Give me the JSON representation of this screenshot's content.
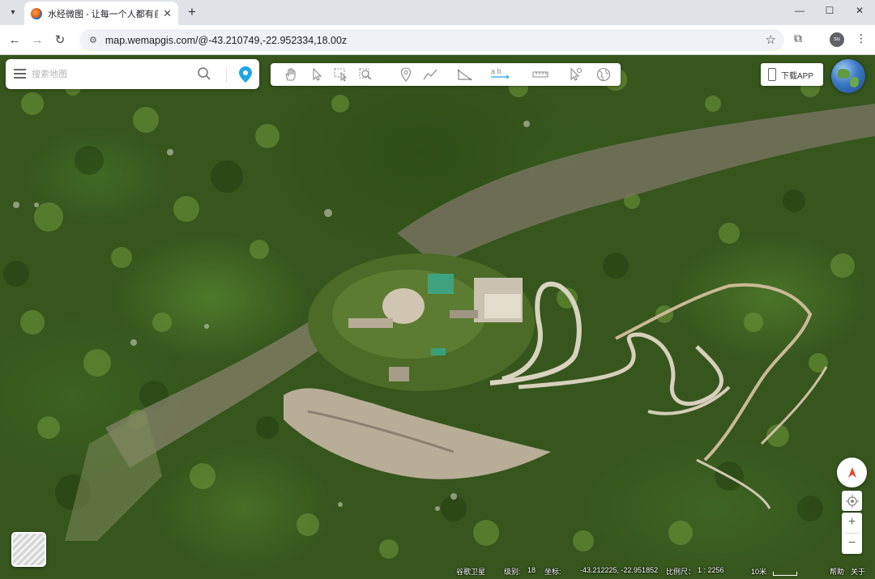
{
  "browser": {
    "tab_title": "水经微图 - 让每一个人都有自己",
    "url": "map.wemapgis.com/@-43.210749,-22.952334,18.00z",
    "profile_initials": "su",
    "new_tab_label": "+",
    "close_tab_label": "✕",
    "minimize_label": "—",
    "maximize_label": "☐",
    "close_window_label": "✕"
  },
  "search": {
    "placeholder": "搜索地图"
  },
  "toolbar": {
    "tools": [
      "pan-hand",
      "select-arrow",
      "box-select",
      "zoom-search",
      "marker",
      "polyline",
      "polygon",
      "text-label",
      "measure-ruler",
      "cursor-info",
      "globe-3d"
    ],
    "text_tool_label": "a b"
  },
  "download_app": {
    "label": "下载APP"
  },
  "status": {
    "source": "谷歌卫星",
    "level_label": "级别:",
    "level_value": "18",
    "coord_label": "坐标:",
    "coord_value": "-43.212225, -22.951852",
    "scale_label": "比例尺：",
    "scale_value": "1 : 2256",
    "scale_bar": "10米",
    "help": "帮助",
    "about": "关于"
  },
  "colors": {
    "accent": "#1fa6e8",
    "compass": "#e0452e"
  }
}
